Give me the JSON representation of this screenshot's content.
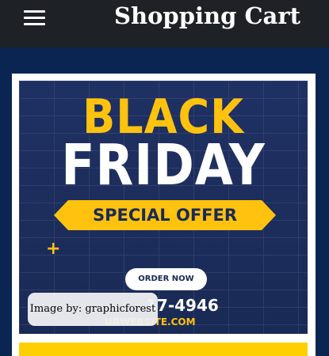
{
  "header": {
    "title": "Shopping Cart",
    "menu_icon": "hamburger-menu-icon",
    "background": "#1e2126"
  },
  "product_card": {
    "banner": {
      "line1": "BLACK",
      "line2": "FRIDAY",
      "ribbon": "SPECIAL OFFER",
      "button": "ORDER NOW",
      "phone": "17-4946",
      "website": "URWEBSITE.COM",
      "accent_color": "#ffc20e"
    },
    "image_credit": "Image by: graphicforest",
    "strip_color": "#ffd000"
  },
  "colors": {
    "page_background": "#0b2552",
    "card_background": "#ffffff"
  }
}
